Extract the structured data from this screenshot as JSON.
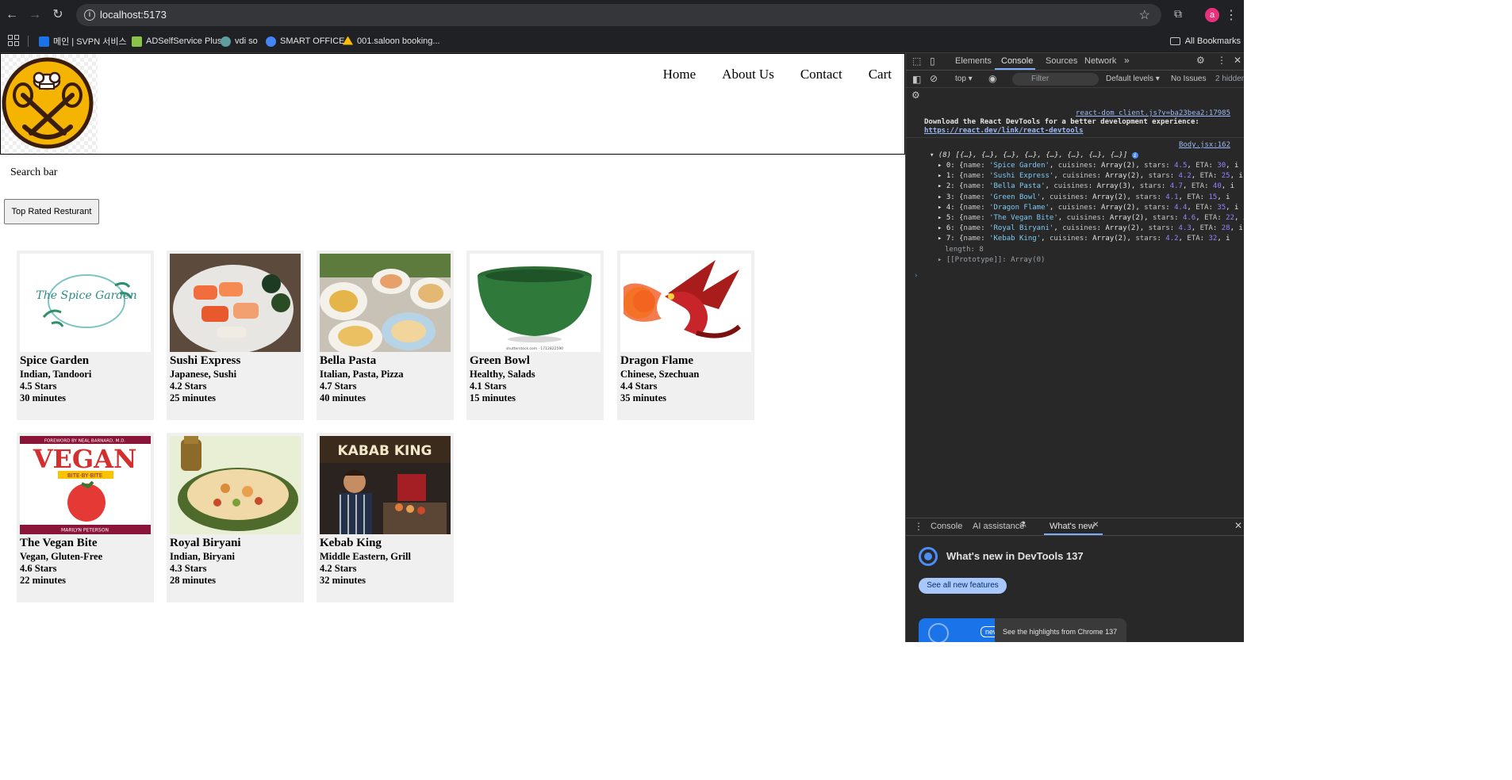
{
  "browser": {
    "url": "localhost:5173",
    "profile_initial": "a",
    "bookmarks": [
      {
        "label": "메인 | SVPN 서비스",
        "color": "#1a73e8"
      },
      {
        "label": "ADSelfService Plus",
        "color": "#8bc34a"
      },
      {
        "label": "vdi so",
        "color": "#5f9ea0"
      },
      {
        "label": "SMART OFFICE",
        "color": "#4285f4"
      },
      {
        "label": "001.saloon booking...",
        "color": "#fbbc04"
      }
    ],
    "all_bookmarks": "All Bookmarks"
  },
  "header": {
    "nav": [
      "Home",
      "About Us",
      "Contact",
      "Cart"
    ]
  },
  "search": {
    "label": "Search bar"
  },
  "filter_button": "Top Rated Resturant",
  "restaurants": [
    {
      "name": "Spice Garden",
      "cuisines": "Indian, Tandoori",
      "stars": "4.5 Stars",
      "eta": "30 minutes",
      "image": "spice-garden-logo",
      "img_text": "The Spice Garden"
    },
    {
      "name": "Sushi Express",
      "cuisines": "Japanese, Sushi",
      "stars": "4.2 Stars",
      "eta": "25 minutes",
      "image": "sushi-platter"
    },
    {
      "name": "Bella Pasta",
      "cuisines": "Italian, Pasta, Pizza",
      "stars": "4.7 Stars",
      "eta": "40 minutes",
      "image": "pasta-dishes"
    },
    {
      "name": "Green Bowl",
      "cuisines": "Healthy, Salads",
      "stars": "4.1 Stars",
      "eta": "15 minutes",
      "image": "green-bowl",
      "img_text": "shutterstock.com · 1712822590"
    },
    {
      "name": "Dragon Flame",
      "cuisines": "Chinese, Szechuan",
      "stars": "4.4 Stars",
      "eta": "35 minutes",
      "image": "red-dragon"
    },
    {
      "name": "The Vegan Bite",
      "cuisines": "Vegan, Gluten-Free",
      "stars": "4.6 Stars",
      "eta": "22 minutes",
      "image": "vegan-book-cover",
      "img_text": "VEGAN",
      "img_subtext": "BITE·BY·BITE",
      "img_top": "FOREWORD BY NEAL BARNARD, M.D.",
      "img_bottom": "MARILYN PETERSON"
    },
    {
      "name": "Royal Biryani",
      "cuisines": "Indian, Biryani",
      "stars": "4.3 Stars",
      "eta": "28 minutes",
      "image": "biryani-plate"
    },
    {
      "name": "Kebab King",
      "cuisines": "Middle Eastern, Grill",
      "stars": "4.2 Stars",
      "eta": "32 minutes",
      "image": "kebab-chef",
      "img_text": "KABAB KING"
    }
  ],
  "devtools": {
    "tabs": [
      "Elements",
      "Console",
      "Sources",
      "Network"
    ],
    "active_tab": "Console",
    "context": "top",
    "filter_placeholder": "Filter",
    "levels": "Default levels",
    "issues": "No Issues",
    "hidden": "2 hidden",
    "console": {
      "source1": "react-dom_client.js?v=ba23bea2:17985",
      "message1": "Download the React DevTools for a better development experience:",
      "link1": "https://react.dev/link/react-devtools",
      "source2": "Body.jsx:162",
      "array_summary": "(8) [{…}, {…}, {…}, {…}, {…}, {…}, {…}, {…}]",
      "entries": [
        {
          "idx": "0",
          "name": "'Spice Garden'",
          "stars": "4.5",
          "eta": "30"
        },
        {
          "idx": "1",
          "name": "'Sushi Express'",
          "stars": "4.2",
          "eta": "25"
        },
        {
          "idx": "2",
          "name": "'Bella Pasta'",
          "cuisines": "Array(3)",
          "stars": "4.7",
          "eta": "40"
        },
        {
          "idx": "3",
          "name": "'Green Bowl'",
          "stars": "4.1",
          "eta": "15"
        },
        {
          "idx": "4",
          "name": "'Dragon Flame'",
          "stars": "4.4",
          "eta": "35"
        },
        {
          "idx": "5",
          "name": "'The Vegan Bite'",
          "stars": "4.6",
          "eta": "22"
        },
        {
          "idx": "6",
          "name": "'Royal Biryani'",
          "stars": "4.3",
          "eta": "28"
        },
        {
          "idx": "7",
          "name": "'Kebab King'",
          "stars": "4.2",
          "eta": "32"
        }
      ],
      "length_label": "length: 8",
      "prototype": "[[Prototype]]: Array(0)"
    },
    "drawer": {
      "tabs": [
        "Console",
        "AI assistance",
        "What's new"
      ],
      "title": "What's new in DevTools 137",
      "button": "See all new features",
      "badge": "new",
      "highlight": "See the highlights from Chrome 137"
    }
  }
}
